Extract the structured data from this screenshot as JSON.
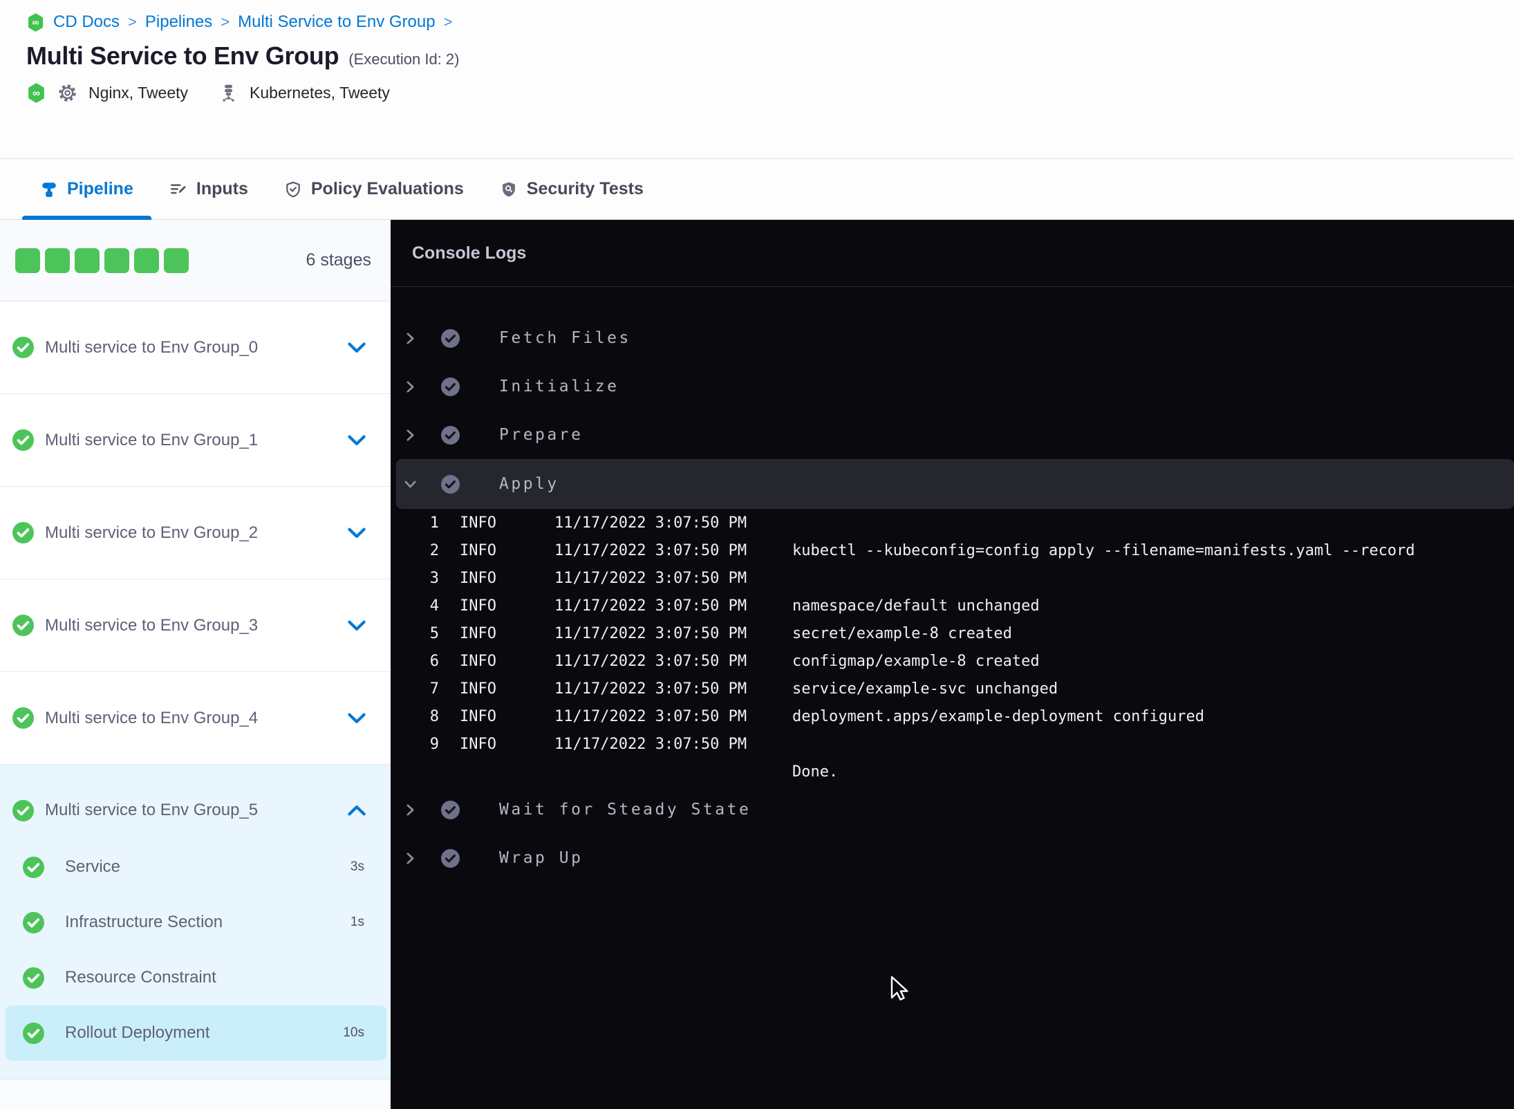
{
  "breadcrumb": {
    "separator": ">",
    "items": [
      "CD Docs",
      "Pipelines",
      "Multi Service to Env Group"
    ]
  },
  "header": {
    "title": "Multi Service to Env Group",
    "execution_label": "(Execution Id: 2)",
    "services_label": "Nginx, Tweety",
    "environments_label": "Kubernetes, Tweety"
  },
  "tabs": [
    {
      "label": "Pipeline",
      "active": true
    },
    {
      "label": "Inputs",
      "active": false
    },
    {
      "label": "Policy Evaluations",
      "active": false
    },
    {
      "label": "Security Tests",
      "active": false
    }
  ],
  "sidebar": {
    "stage_count_label": "6 stages",
    "progress_squares": 6,
    "stages": [
      {
        "label": "Multi service to Env Group_0",
        "status": "success",
        "expanded": false
      },
      {
        "label": "Multi service to Env Group_1",
        "status": "success",
        "expanded": false
      },
      {
        "label": "Multi service to Env Group_2",
        "status": "success",
        "expanded": false
      },
      {
        "label": "Multi service to Env Group_3",
        "status": "success",
        "expanded": false
      },
      {
        "label": "Multi service to Env Group_4",
        "status": "success",
        "expanded": false
      },
      {
        "label": "Multi service to Env Group_5",
        "status": "success",
        "expanded": true,
        "steps": [
          {
            "label": "Service",
            "duration": "3s",
            "status": "success",
            "selected": false
          },
          {
            "label": "Infrastructure Section",
            "duration": "1s",
            "status": "success",
            "selected": false
          },
          {
            "label": "Resource Constraint",
            "duration": "",
            "status": "success",
            "selected": false
          },
          {
            "label": "Rollout Deployment",
            "duration": "10s",
            "status": "success",
            "selected": true
          }
        ]
      }
    ]
  },
  "console": {
    "title": "Console Logs",
    "sections": [
      {
        "label": "Fetch Files",
        "status": "success",
        "expanded": false
      },
      {
        "label": "Initialize",
        "status": "success",
        "expanded": false
      },
      {
        "label": "Prepare",
        "status": "success",
        "expanded": false
      },
      {
        "label": "Apply",
        "status": "success",
        "expanded": true,
        "logs": [
          {
            "num": "1",
            "level": "INFO",
            "time": "11/17/2022 3:07:50 PM",
            "message": ""
          },
          {
            "num": "2",
            "level": "INFO",
            "time": "11/17/2022 3:07:50 PM",
            "message": "kubectl --kubeconfig=config apply --filename=manifests.yaml --record"
          },
          {
            "num": "3",
            "level": "INFO",
            "time": "11/17/2022 3:07:50 PM",
            "message": ""
          },
          {
            "num": "4",
            "level": "INFO",
            "time": "11/17/2022 3:07:50 PM",
            "message": "namespace/default unchanged"
          },
          {
            "num": "5",
            "level": "INFO",
            "time": "11/17/2022 3:07:50 PM",
            "message": "secret/example-8 created"
          },
          {
            "num": "6",
            "level": "INFO",
            "time": "11/17/2022 3:07:50 PM",
            "message": "configmap/example-8 created"
          },
          {
            "num": "7",
            "level": "INFO",
            "time": "11/17/2022 3:07:50 PM",
            "message": "service/example-svc unchanged"
          },
          {
            "num": "8",
            "level": "INFO",
            "time": "11/17/2022 3:07:50 PM",
            "message": "deployment.apps/example-deployment configured"
          },
          {
            "num": "9",
            "level": "INFO",
            "time": "11/17/2022 3:07:50 PM",
            "message": ""
          },
          {
            "num": "",
            "level": "",
            "time": "",
            "message": "Done."
          }
        ]
      },
      {
        "label": "Wait for Steady State",
        "status": "success",
        "expanded": false
      },
      {
        "label": "Wrap Up",
        "status": "success",
        "expanded": false
      }
    ]
  },
  "icons": {
    "infinity_glyph": "∞"
  },
  "colors": {
    "accent_blue": "#0278d5",
    "success_green": "#4dc45a",
    "console_bg": "#0a0a0e",
    "selected_step_bg": "#cbeefb",
    "expanded_stage_bg": "#e9f6fd"
  }
}
